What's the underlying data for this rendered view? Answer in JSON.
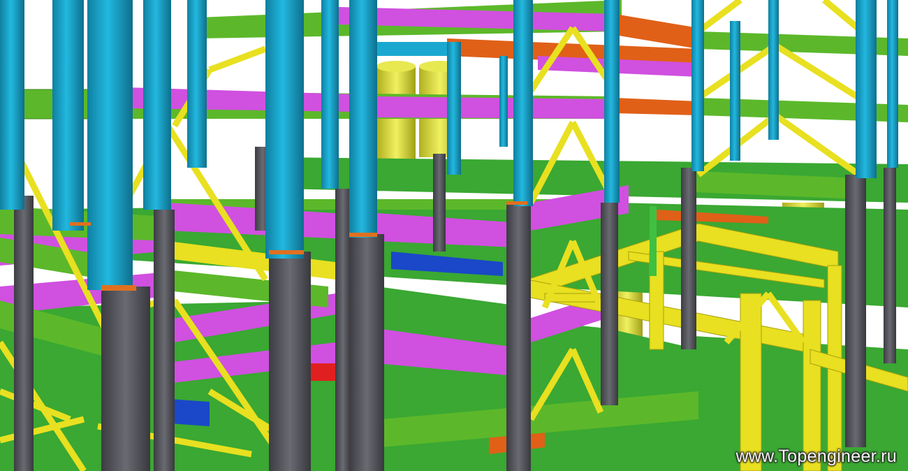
{
  "watermark": "www.Topengineer.ru",
  "colors": {
    "background": "#ffffff",
    "column_blue": "#1aa8d0",
    "column_blue_dark": "#0f7fa0",
    "column_gray": "#5a5a62",
    "column_gray_dark": "#3c3c42",
    "beam_green": "#5cb82a",
    "beam_green_dark": "#3f8a1c",
    "deck_green": "#3aa832",
    "beam_magenta": "#d050e0",
    "beam_magenta_dark": "#9a2aa8",
    "brace_yellow": "#e8e020",
    "brace_yellow_dark": "#a8a010",
    "beam_orange": "#e06018",
    "tank_yellow": "#e0e040",
    "beam_red": "#e02020",
    "beam_navy": "#1a48c8"
  }
}
